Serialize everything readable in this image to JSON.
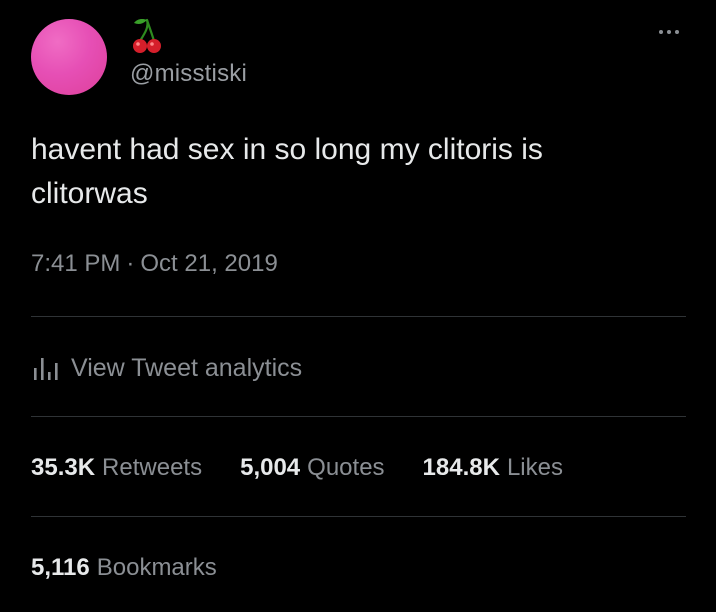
{
  "tweet": {
    "display_name_icon": "cherry-emoji",
    "handle": "@misstiski",
    "text": "havent had sex in so long my clitoris is\nclitorwas",
    "time": "7:41 PM",
    "separator": "·",
    "date": "Oct 21, 2019",
    "more_icon": "more-horizontal-icon"
  },
  "analytics": {
    "icon": "analytics-bar-icon",
    "label": "View Tweet analytics"
  },
  "stats": {
    "retweets": {
      "count": "35.3K",
      "label": "Retweets"
    },
    "quotes": {
      "count": "5,004",
      "label": "Quotes"
    },
    "likes": {
      "count": "184.8K",
      "label": "Likes"
    },
    "bookmarks": {
      "count": "5,116",
      "label": "Bookmarks"
    }
  },
  "colors": {
    "background": "#000000",
    "text_primary": "#e7e9ea",
    "text_secondary": "#8b8f94",
    "divider": "#2f3336",
    "avatar": "#e64fb5"
  }
}
